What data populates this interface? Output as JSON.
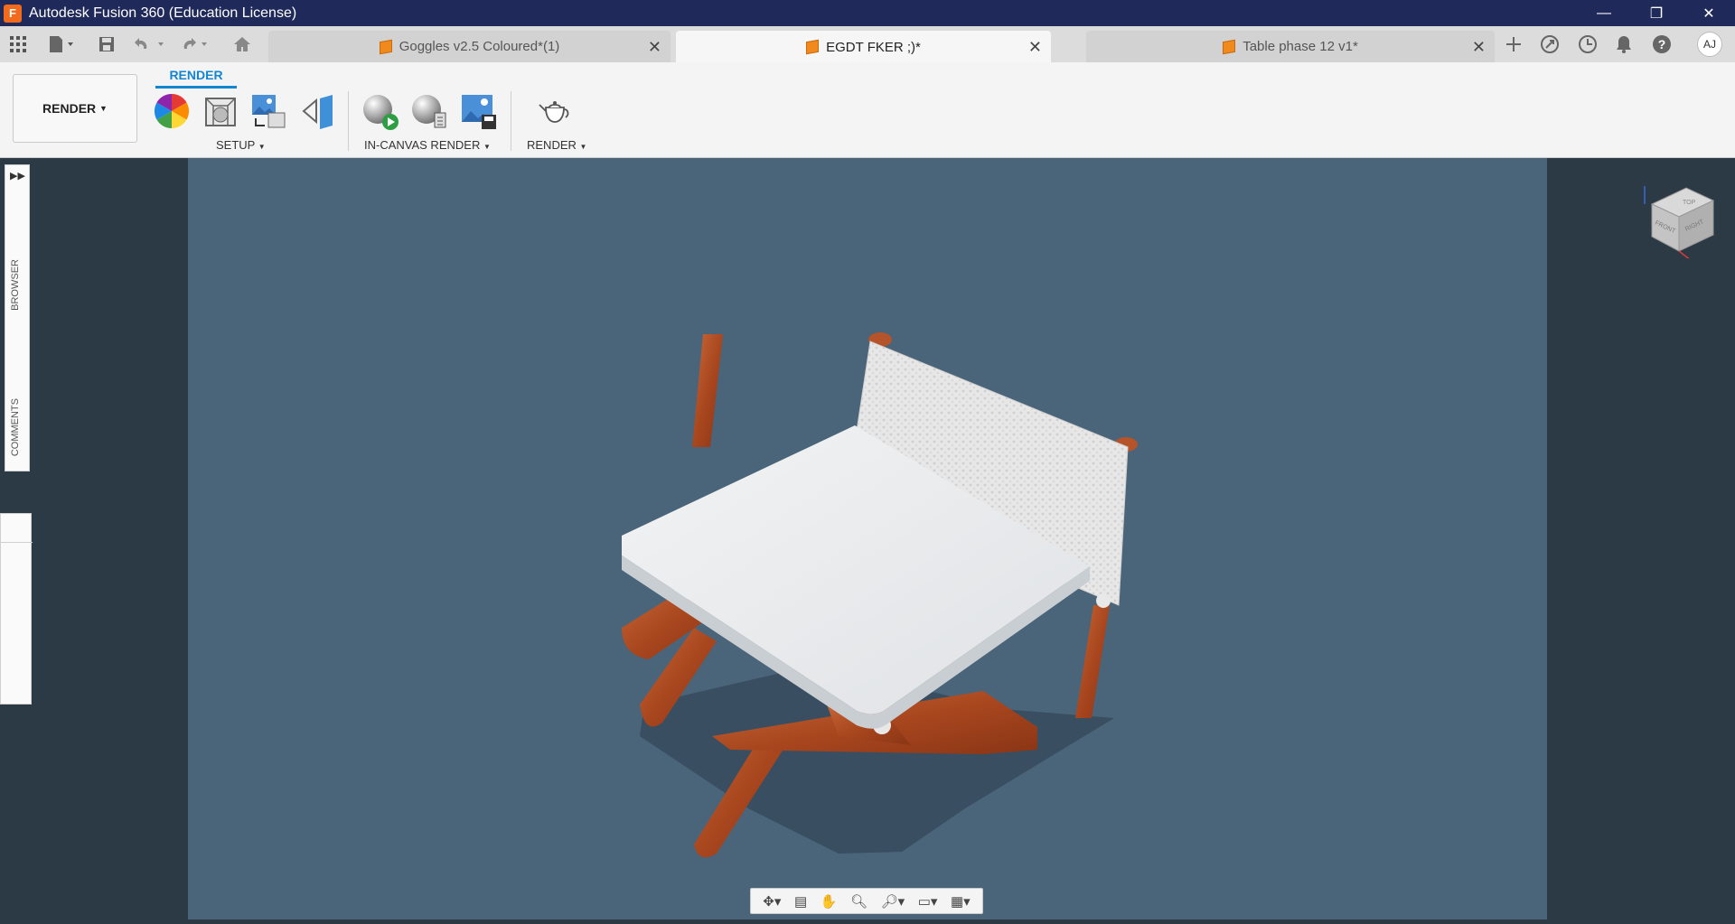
{
  "titlebar": {
    "app_icon_letter": "F",
    "title": "Autodesk Fusion 360 (Education License)",
    "minimize_glyph": "—",
    "restore_glyph": "❐",
    "close_glyph": "✕"
  },
  "tabs": [
    {
      "label": "Goggles v2.5 Coloured*(1)",
      "active": false
    },
    {
      "label": "EGDT FKER ;)*",
      "active": true
    },
    {
      "label": "Table phase 12 v1*",
      "active": false
    }
  ],
  "user": {
    "initials": "AJ"
  },
  "ribbon": {
    "workspace_label": "RENDER",
    "active_tab": "RENDER",
    "groups": {
      "setup": "SETUP",
      "in_canvas_render": "IN-CANVAS RENDER",
      "render": "RENDER"
    }
  },
  "left_panel": {
    "browser_label": "BROWSER",
    "comments_label": "COMMENTS"
  },
  "viewcube": {
    "top": "TOP",
    "front": "FRONT",
    "right": "RIGHT"
  },
  "colors": {
    "titlebar": "#1f2a5a",
    "canvas": "#4a6479",
    "accent": "#1386d1",
    "wood": "#b5532a"
  }
}
